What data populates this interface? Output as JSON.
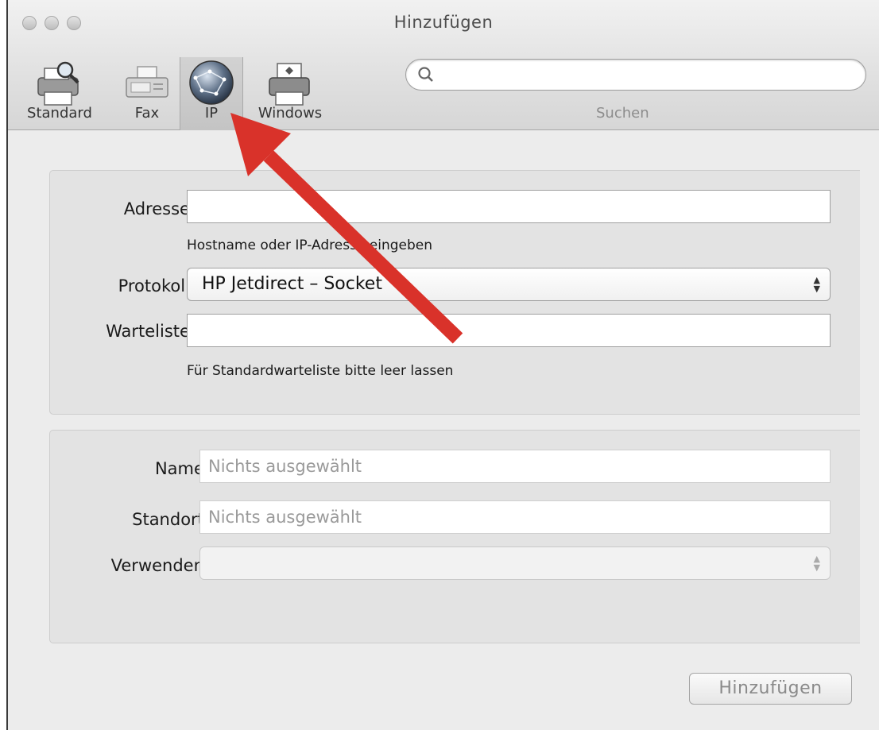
{
  "window": {
    "title": "Hinzufügen"
  },
  "toolbar": {
    "items": [
      {
        "label": "Standard",
        "icon": "printer-search-icon"
      },
      {
        "label": "Fax",
        "icon": "fax-icon"
      },
      {
        "label": "IP",
        "icon": "globe-icon",
        "selected": true
      },
      {
        "label": "Windows",
        "icon": "printer-windows-icon"
      }
    ],
    "search": {
      "placeholder": "",
      "label": "Suchen"
    }
  },
  "connection": {
    "address_label": "Adresse:",
    "address_value": "",
    "address_hint": "Hostname oder IP-Adresse eingeben",
    "protocol_label": "Protokoll:",
    "protocol_value": "HP Jetdirect – Socket",
    "queue_label": "Warteliste:",
    "queue_value": "",
    "queue_hint": "Für Standardwarteliste bitte leer lassen"
  },
  "details": {
    "name_label": "Name:",
    "name_placeholder": "Nichts ausgewählt",
    "location_label": "Standort:",
    "location_placeholder": "Nichts ausgewählt",
    "use_label": "Verwenden:",
    "use_value": ""
  },
  "actions": {
    "add_label": "Hinzufügen"
  },
  "colors": {
    "annotation_arrow": "#d9322a"
  }
}
